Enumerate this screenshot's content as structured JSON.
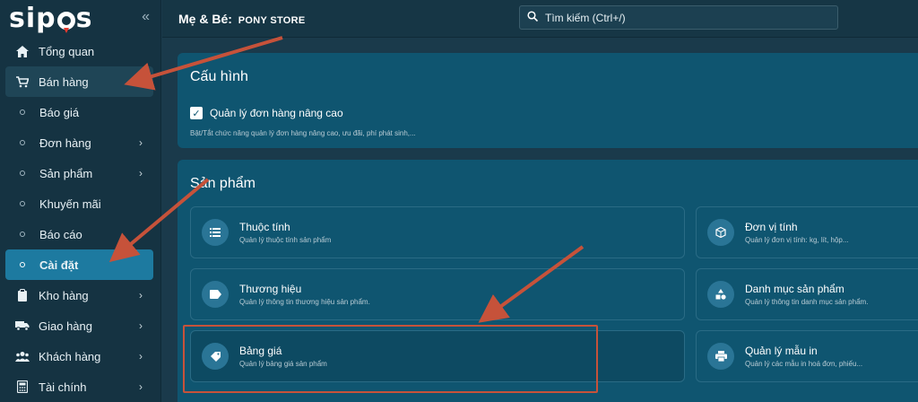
{
  "sidebar": {
    "logo": "sipos",
    "collapse_icon": "double-chevron-left-icon",
    "items": [
      {
        "label": "Tổng quan",
        "icon": "home-icon"
      },
      {
        "label": "Bán hàng",
        "icon": "cart-icon"
      },
      {
        "label": "Báo giá"
      },
      {
        "label": "Đơn hàng"
      },
      {
        "label": "Sản phẩm"
      },
      {
        "label": "Khuyến mãi"
      },
      {
        "label": "Báo cáo"
      },
      {
        "label": "Cài đặt"
      },
      {
        "label": "Kho hàng",
        "icon": "clipboard-icon"
      },
      {
        "label": "Giao hàng",
        "icon": "truck-icon"
      },
      {
        "label": "Khách hàng",
        "icon": "users-icon"
      },
      {
        "label": "Tài chính",
        "icon": "calculator-icon"
      }
    ]
  },
  "header": {
    "category": "Mẹ & Bé:",
    "store_name": "PONY STORE",
    "search_placeholder": "Tìm kiếm (Ctrl+/)"
  },
  "config_card": {
    "title": "Cấu hình",
    "checkbox_label": "Quản lý đơn hàng nâng cao",
    "checked": true,
    "hint": "Bật/Tắt chức năng quản lý đơn hàng nâng cao, ưu đãi, phí phát sinh,..."
  },
  "product_card": {
    "title": "Sản phẩm",
    "tiles": [
      {
        "title": "Thuộc tính",
        "subtitle": "Quản lý thuộc tính sản phẩm",
        "icon": "list-icon"
      },
      {
        "title": "Đơn vị tính",
        "subtitle": "Quản lý đơn vị tính: kg, lít, hộp...",
        "icon": "package-icon"
      },
      {
        "title": "Thương hiệu",
        "subtitle": "Quản lý thông tin thương hiệu sản phẩm.",
        "icon": "tag-icon"
      },
      {
        "title": "Danh mục sản phẩm",
        "subtitle": "Quản lý thông tin danh mục sản phẩm.",
        "icon": "shapes-icon"
      },
      {
        "title": "Bảng giá",
        "subtitle": "Quản lý bảng giá sản phẩm",
        "icon": "price-tag-icon"
      },
      {
        "title": "Quản lý mẫu in",
        "subtitle": "Quản lý các mẫu in hoá đơn, phiếu...",
        "icon": "printer-icon"
      }
    ]
  },
  "colors": {
    "sidebar_bg": "#153342",
    "active_item": "#1d7aa0",
    "card_bg": "#0f5570",
    "annotation": "#c6523a"
  }
}
